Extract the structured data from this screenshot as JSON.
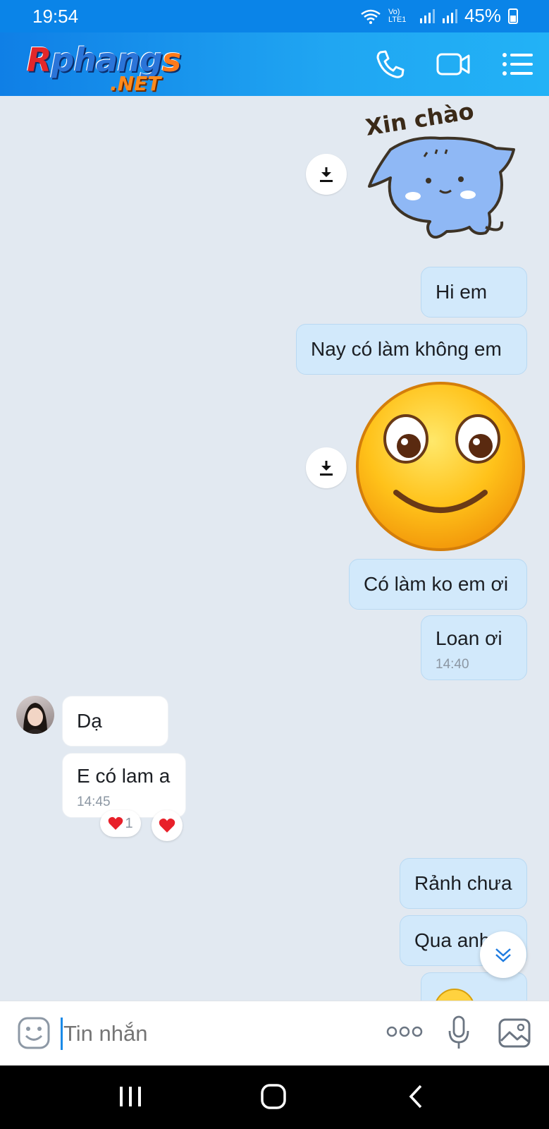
{
  "status_bar": {
    "time": "19:54",
    "battery": "45%",
    "network": "Vo) LTE1"
  },
  "logo": {
    "word": "Rphangs",
    "suffix": ".NET"
  },
  "header": {
    "icons": [
      "phone-icon",
      "video-camera-icon",
      "menu-list-icon"
    ]
  },
  "sticker": {
    "caption": "Xin chào"
  },
  "messages": [
    {
      "from": "me",
      "text": "Hi em"
    },
    {
      "from": "me",
      "text": "Nay có làm không em"
    },
    {
      "from": "me",
      "text": "Có làm ko em ơi"
    },
    {
      "from": "me",
      "text": "Loan ơi",
      "time": "14:40"
    },
    {
      "from": "them",
      "text": "Dạ"
    },
    {
      "from": "them",
      "text": "E có lam a",
      "time": "14:45",
      "reaction_count": "1"
    },
    {
      "from": "me",
      "text": "Rảnh chưa"
    },
    {
      "from": "me",
      "text": "Qua anh"
    }
  ],
  "input": {
    "placeholder": "Tin nhắn"
  },
  "colors": {
    "header": "#1e9bf0",
    "my_bubble": "#d2e9fb",
    "background": "#e2e9f1",
    "reaction": "#e8202a"
  }
}
